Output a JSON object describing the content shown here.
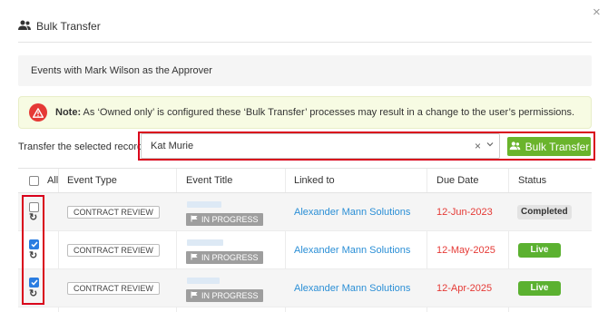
{
  "dialog": {
    "title": "Bulk Transfer",
    "close_glyph": "×",
    "context_text": "Events with Mark Wilson as the Approver"
  },
  "note": {
    "label": "Note:",
    "text": " As ‘Owned only’ is configured these ‘Bulk Transfer’ processes may result in a change to the user’s permissions.",
    "icon": "warning-icon"
  },
  "transfer": {
    "label": "Transfer the selected records to",
    "selected_user": "Kat Murie",
    "clear_glyph": "×",
    "chevron_glyph": "⌄",
    "button_label": "Bulk Transfer",
    "button_color": "#6ab42c"
  },
  "table": {
    "headers": {
      "all": "All",
      "event_type": "Event Type",
      "event_title": "Event Title",
      "linked_to": "Linked to",
      "due_date": "Due Date",
      "status": "Status"
    },
    "rows": [
      {
        "checked": false,
        "event_type": "CONTRACT REVIEW",
        "event_title": "",
        "progress": "IN PROGRESS",
        "linked_to": "Alexander Mann Solutions",
        "due_date": "12-Jun-2023",
        "status": "Completed"
      },
      {
        "checked": true,
        "event_type": "CONTRACT REVIEW",
        "event_title": "",
        "progress": "IN PROGRESS",
        "linked_to": "Alexander Mann Solutions",
        "due_date": "12-May-2025",
        "status": "Live"
      },
      {
        "checked": true,
        "event_type": "CONTRACT REVIEW",
        "event_title": "",
        "progress": "IN PROGRESS",
        "linked_to": "Alexander Mann Solutions",
        "due_date": "12-Apr-2025",
        "status": "Live"
      }
    ]
  },
  "colors": {
    "highlight": "#d9001b",
    "link": "#2b8fd6",
    "due_date": "#e53935",
    "live": "#5bb130",
    "checkbox": "#2b7de1"
  },
  "refresh_glyph": "↻"
}
